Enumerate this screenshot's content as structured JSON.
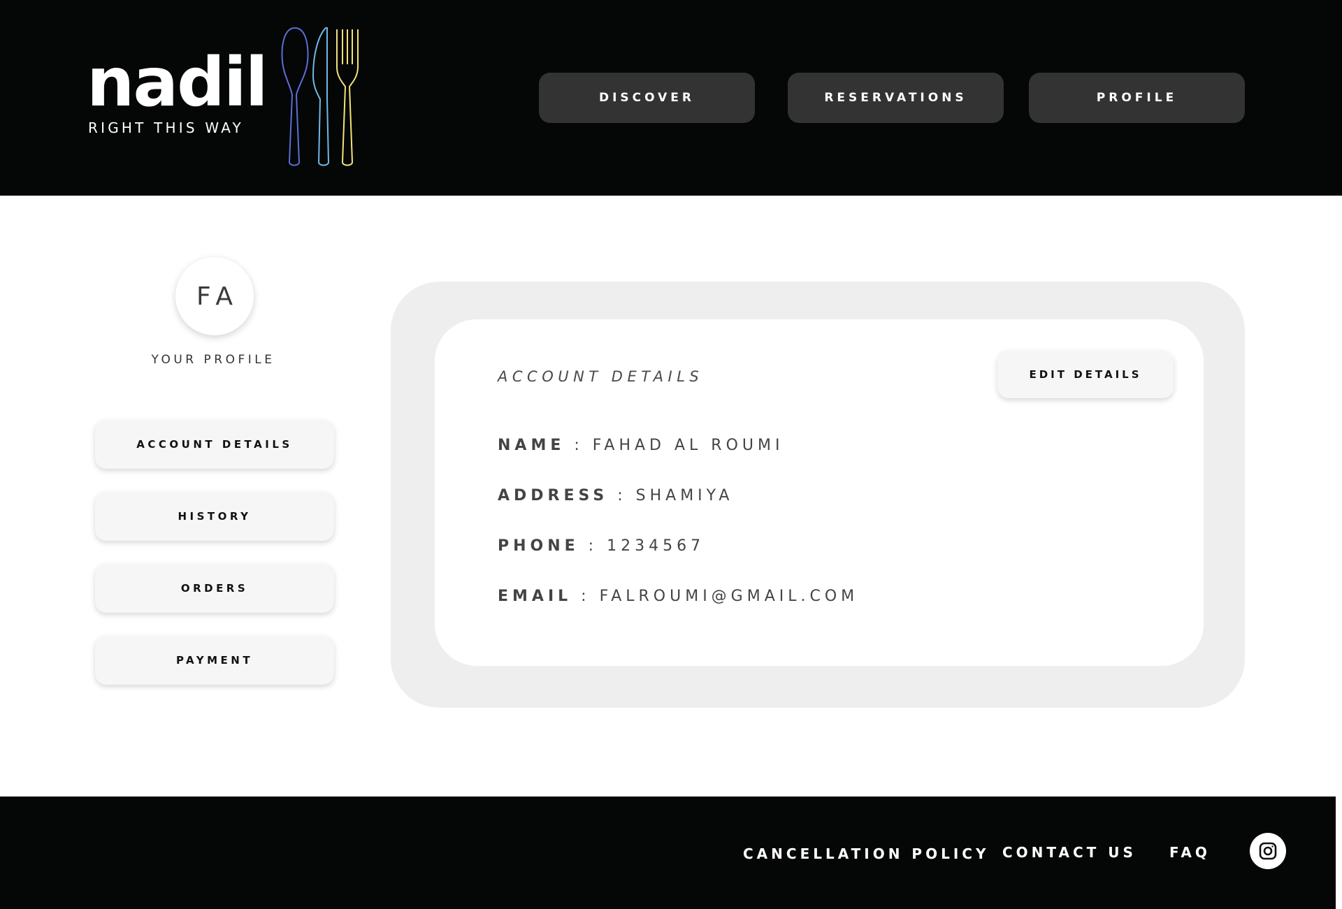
{
  "brand": {
    "name": "nadil",
    "tagline": "RIGHT THIS WAY",
    "icon": "cutlery-icon",
    "icon_colors": [
      "#5a6fd8",
      "#6fb9e6",
      "#f2e37a"
    ]
  },
  "nav": {
    "discover": "DISCOVER",
    "reservations": "RESERVATIONS",
    "profile": "PROFILE"
  },
  "sidebar": {
    "initials": "FA",
    "profile_label": "YOUR PROFILE",
    "items": [
      {
        "label": "ACCOUNT DETAILS"
      },
      {
        "label": "HISTORY"
      },
      {
        "label": "ORDERS"
      },
      {
        "label": "PAYMENT"
      }
    ]
  },
  "account": {
    "title": "ACCOUNT DETAILS",
    "edit_label": "EDIT DETAILS",
    "fields": [
      {
        "label": "NAME",
        "sep": " : ",
        "value": "FAHAD AL ROUMI"
      },
      {
        "label": "ADDRESS",
        "sep": " : ",
        "value": "SHAMIYA"
      },
      {
        "label": "PHONE",
        "sep": " : ",
        "value": "1234567"
      },
      {
        "label": "EMAIL",
        "sep": " : ",
        "value": "FALROUMI@GMAIL.COM"
      }
    ]
  },
  "footer": {
    "cancellation": "CANCELLATION POLICY",
    "contact": "CONTACT US",
    "faq": "FAQ",
    "social_icon": "instagram-icon"
  },
  "colors": {
    "header_bg": "#050606",
    "nav_button_bg": "#333333",
    "panel_bg": "#eeeeee",
    "button_bg": "#f6f6f6"
  }
}
